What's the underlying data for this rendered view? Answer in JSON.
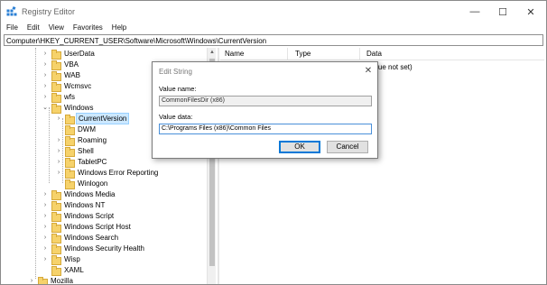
{
  "window": {
    "title": "Registry Editor",
    "minimize_glyph": "—",
    "maximize_glyph": "☐",
    "close_glyph": "✕"
  },
  "menu": [
    "File",
    "Edit",
    "View",
    "Favorites",
    "Help"
  ],
  "address": "Computer\\HKEY_CURRENT_USER\\Software\\Microsoft\\Windows\\CurrentVersion",
  "tree": {
    "items": [
      {
        "label": "UserData",
        "expander": "›"
      },
      {
        "label": "VBA",
        "expander": "›"
      },
      {
        "label": "WAB",
        "expander": "›"
      },
      {
        "label": "Wcmsvc",
        "expander": "›"
      },
      {
        "label": "wfs",
        "expander": "›"
      },
      {
        "label": "Windows",
        "expander": "⌄"
      },
      {
        "label": "CurrentVersion",
        "expander": "›",
        "selected": true
      },
      {
        "label": "DWM",
        "expander": ""
      },
      {
        "label": "Roaming",
        "expander": "›"
      },
      {
        "label": "Shell",
        "expander": "›"
      },
      {
        "label": "TabletPC",
        "expander": "›"
      },
      {
        "label": "Windows Error Reporting",
        "expander": "›"
      },
      {
        "label": "Winlogon",
        "expander": ""
      },
      {
        "label": "Windows Media",
        "expander": "›"
      },
      {
        "label": "Windows NT",
        "expander": "›"
      },
      {
        "label": "Windows Script",
        "expander": "›"
      },
      {
        "label": "Windows Script Host",
        "expander": "›"
      },
      {
        "label": "Windows Search",
        "expander": "›"
      },
      {
        "label": "Windows Security Health",
        "expander": "›"
      },
      {
        "label": "Wisp",
        "expander": "›"
      },
      {
        "label": "XAML",
        "expander": ""
      },
      {
        "label": "Mozilla",
        "expander": "›"
      }
    ]
  },
  "list": {
    "columns": [
      "Name",
      "Type",
      "Data"
    ],
    "first_row_data": "(value not set)"
  },
  "dialog": {
    "title": "Edit String",
    "close_glyph": "✕",
    "value_name_label": "Value name:",
    "value_name": "CommonFilesDir (x86)",
    "value_data_label": "Value data:",
    "value_data": "C:\\Programs  Files (x86)\\Common Files",
    "ok_label": "OK",
    "cancel_label": "Cancel"
  },
  "colors": {
    "selection": "#cce8ff",
    "folder": "#f6d26b",
    "accent": "#0078d7"
  }
}
